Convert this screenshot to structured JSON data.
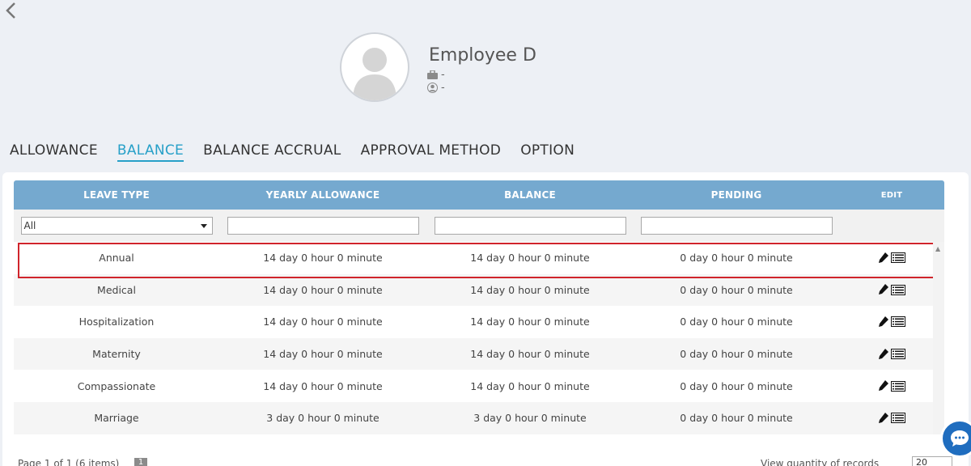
{
  "header": {
    "back_icon": "chevron-left-icon"
  },
  "employee": {
    "name": "Employee D",
    "job": "-",
    "id": "-",
    "avatar_icon": "person-silhouette-icon"
  },
  "tabs": [
    {
      "label": "ALLOWANCE",
      "active": false
    },
    {
      "label": "BALANCE",
      "active": true
    },
    {
      "label": "BALANCE ACCRUAL",
      "active": false
    },
    {
      "label": "APPROVAL METHOD",
      "active": false
    },
    {
      "label": "OPTION",
      "active": false
    }
  ],
  "table": {
    "columns": [
      "LEAVE TYPE",
      "YEARLY ALLOWANCE",
      "BALANCE",
      "PENDING",
      "EDIT"
    ],
    "filter": {
      "leave_type": "All"
    },
    "rows": [
      {
        "type": "Annual",
        "allowance": "14 day 0 hour 0 minute",
        "balance": "14 day 0 hour 0 minute",
        "pending": "0 day 0 hour 0 minute"
      },
      {
        "type": "Medical",
        "allowance": "14 day 0 hour 0 minute",
        "balance": "14 day 0 hour 0 minute",
        "pending": "0 day 0 hour 0 minute"
      },
      {
        "type": "Hospitalization",
        "allowance": "14 day 0 hour 0 minute",
        "balance": "14 day 0 hour 0 minute",
        "pending": "0 day 0 hour 0 minute"
      },
      {
        "type": "Maternity",
        "allowance": "14 day 0 hour 0 minute",
        "balance": "14 day 0 hour 0 minute",
        "pending": "0 day 0 hour 0 minute"
      },
      {
        "type": "Compassionate",
        "allowance": "14 day 0 hour 0 minute",
        "balance": "14 day 0 hour 0 minute",
        "pending": "0 day 0 hour 0 minute"
      },
      {
        "type": "Marriage",
        "allowance": "3 day 0 hour 0 minute",
        "balance": "3 day 0 hour 0 minute",
        "pending": "0 day 0 hour 0 minute"
      }
    ]
  },
  "pager": {
    "summary": "Page 1 of 1 (6 items)",
    "current_page": "1",
    "per_page_label": "View quantity of records",
    "per_page": "20"
  },
  "colors": {
    "accent": "#27a0c8",
    "header": "#75a9cf",
    "highlight": "#d0242b",
    "chat": "#1f6dbf"
  }
}
